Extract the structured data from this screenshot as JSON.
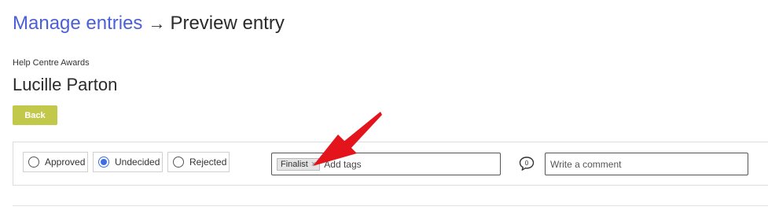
{
  "breadcrumb": {
    "parent_label": "Manage entries",
    "separator": "→",
    "current_label": "Preview entry"
  },
  "entry": {
    "subtitle": "Help Centre Awards",
    "name": "Lucille Parton"
  },
  "actions": {
    "back_label": "Back"
  },
  "moderation": {
    "options": [
      {
        "label": "Approved",
        "checked": false
      },
      {
        "label": "Undecided",
        "checked": true
      },
      {
        "label": "Rejected",
        "checked": false
      }
    ],
    "tags": [
      {
        "label": "Finalist"
      }
    ],
    "tags_placeholder": "Add tags",
    "comment_count": "0",
    "comment_placeholder": "Write a comment"
  },
  "colors": {
    "link": "#4a5fd8",
    "back_button": "#c2c94a",
    "radio_selected": "#3d6de6",
    "annotation_arrow": "#e3141b"
  },
  "icons": {
    "tag_remove": "close-icon",
    "comment": "speech-bubble-icon",
    "annotation": "red-arrow-icon"
  }
}
